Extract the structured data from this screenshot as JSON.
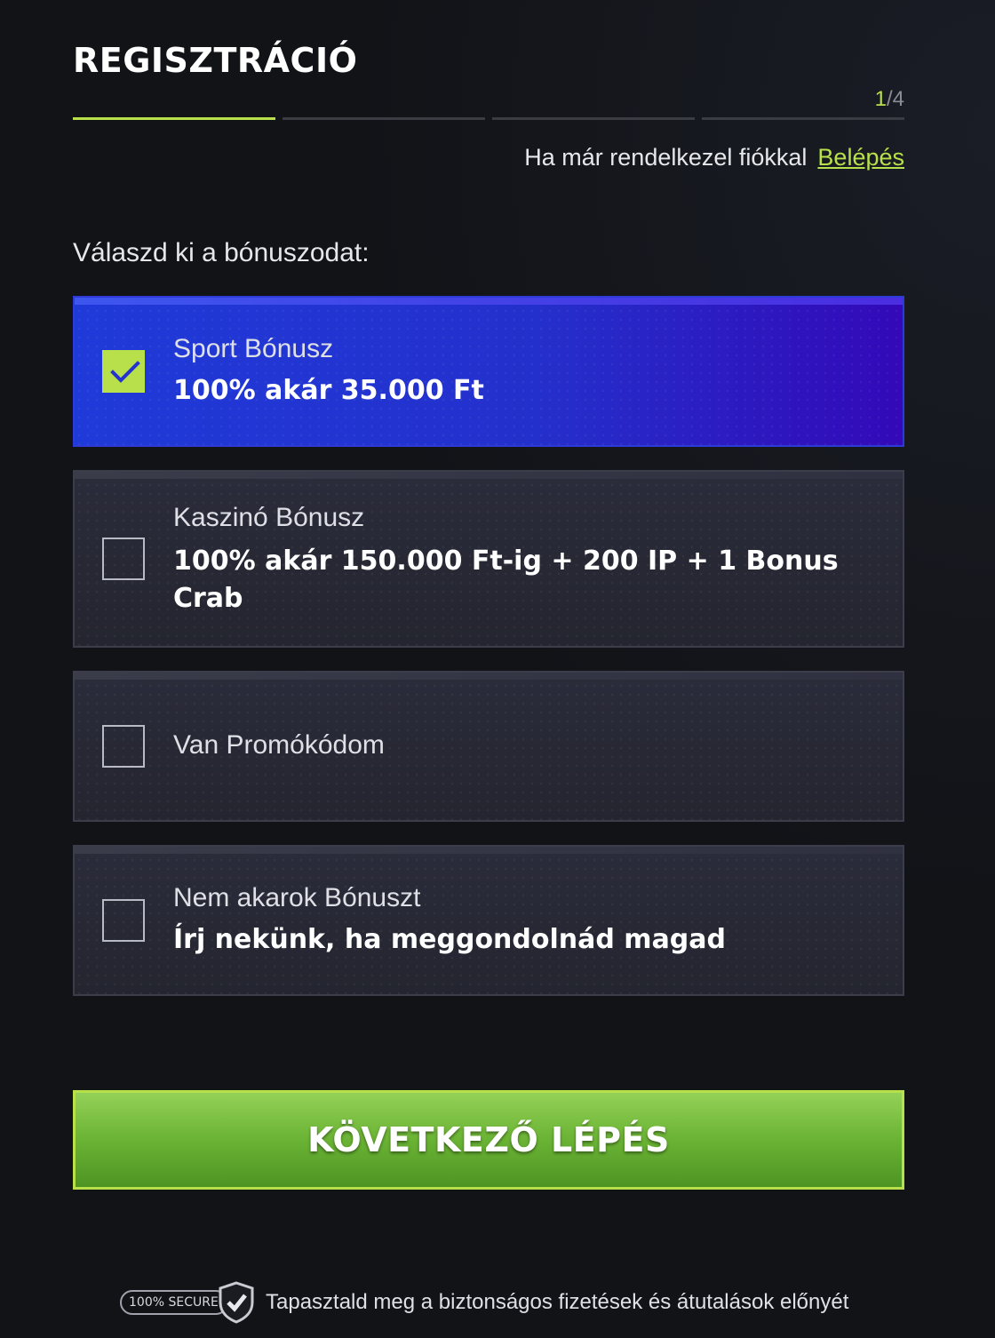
{
  "header": {
    "title": "REGISZTRÁCIÓ",
    "step_current": "1",
    "step_total": "/4",
    "progress_segments": 4,
    "progress_active": 1
  },
  "login": {
    "prompt": "Ha már rendelkezel fiókkal",
    "link": "Belépés"
  },
  "bonus": {
    "label": "Válaszd ki a bónuszodat:",
    "options": [
      {
        "title": "Sport Bónusz",
        "subtitle": "100% akár 35.000 Ft",
        "selected": true
      },
      {
        "title": "Kaszinó Bónusz",
        "subtitle": "100% akár 150.000 Ft-ig + 200 IP + 1 Bonus Crab",
        "selected": false
      },
      {
        "title": "Van Promókódom",
        "subtitle": "",
        "selected": false
      },
      {
        "title": "Nem akarok Bónuszt",
        "subtitle": "Írj nekünk, ha meggondolnád magad",
        "selected": false
      }
    ]
  },
  "next_button": "KÖVETKEZŐ LÉPÉS",
  "footer": {
    "badge": "100% SECURE",
    "text": "Tapasztald meg a biztonságos fizetések és átutalások előnyét"
  },
  "colors": {
    "accent": "#b8e04a",
    "selected_option": "#2430cc",
    "button": "#6ab334",
    "background": "#121317"
  },
  "icons": [
    "checkmark-icon",
    "shield-check-icon"
  ]
}
